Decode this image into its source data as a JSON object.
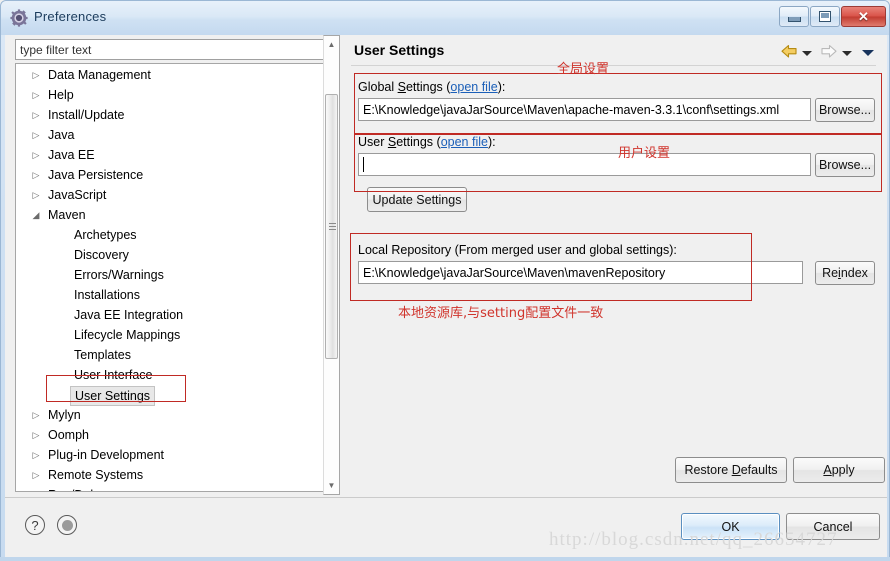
{
  "window": {
    "title": "Preferences",
    "icon": "gear-icon",
    "buttons": {
      "minimize": "minimize",
      "maximize": "maximize",
      "close": "✕"
    }
  },
  "sidebar": {
    "filter_placeholder": "type filter text",
    "items": [
      {
        "label": "Data Management",
        "level": 0,
        "expandable": true,
        "expanded": false,
        "selected": false
      },
      {
        "label": "Help",
        "level": 0,
        "expandable": true,
        "expanded": false,
        "selected": false
      },
      {
        "label": "Install/Update",
        "level": 0,
        "expandable": true,
        "expanded": false,
        "selected": false
      },
      {
        "label": "Java",
        "level": 0,
        "expandable": true,
        "expanded": false,
        "selected": false
      },
      {
        "label": "Java EE",
        "level": 0,
        "expandable": true,
        "expanded": false,
        "selected": false
      },
      {
        "label": "Java Persistence",
        "level": 0,
        "expandable": true,
        "expanded": false,
        "selected": false
      },
      {
        "label": "JavaScript",
        "level": 0,
        "expandable": true,
        "expanded": false,
        "selected": false
      },
      {
        "label": "Maven",
        "level": 0,
        "expandable": true,
        "expanded": true,
        "selected": false
      },
      {
        "label": "Archetypes",
        "level": 1,
        "expandable": false,
        "expanded": false,
        "selected": false
      },
      {
        "label": "Discovery",
        "level": 1,
        "expandable": false,
        "expanded": false,
        "selected": false
      },
      {
        "label": "Errors/Warnings",
        "level": 1,
        "expandable": false,
        "expanded": false,
        "selected": false
      },
      {
        "label": "Installations",
        "level": 1,
        "expandable": false,
        "expanded": false,
        "selected": false
      },
      {
        "label": "Java EE Integration",
        "level": 1,
        "expandable": false,
        "expanded": false,
        "selected": false
      },
      {
        "label": "Lifecycle Mappings",
        "level": 1,
        "expandable": false,
        "expanded": false,
        "selected": false
      },
      {
        "label": "Templates",
        "level": 1,
        "expandable": false,
        "expanded": false,
        "selected": false
      },
      {
        "label": "User Interface",
        "level": 1,
        "expandable": false,
        "expanded": false,
        "selected": false
      },
      {
        "label": "User Settings",
        "level": 1,
        "expandable": false,
        "expanded": false,
        "selected": true
      },
      {
        "label": "Mylyn",
        "level": 0,
        "expandable": true,
        "expanded": false,
        "selected": false
      },
      {
        "label": "Oomph",
        "level": 0,
        "expandable": true,
        "expanded": false,
        "selected": false
      },
      {
        "label": "Plug-in Development",
        "level": 0,
        "expandable": true,
        "expanded": false,
        "selected": false
      },
      {
        "label": "Remote Systems",
        "level": 0,
        "expandable": true,
        "expanded": false,
        "selected": false
      },
      {
        "label": "Run/Debug",
        "level": 0,
        "expandable": true,
        "expanded": false,
        "selected": false
      }
    ],
    "twisty_collapsed": "▷",
    "twisty_expanded": "◢",
    "scrollbar": {
      "up": "▲",
      "down": "▼"
    }
  },
  "panel": {
    "title": "User Settings",
    "nav": {
      "back": "back-arrow",
      "back_caret": "▼",
      "forward": "forward-arrow",
      "forward_caret": "▼",
      "menu_caret": "▼"
    },
    "global_settings": {
      "label_pre": "Global ",
      "label_mnemonic": "S",
      "label_post": "ettings (",
      "link": "open file",
      "label_end": "):",
      "value": "E:\\Knowledge\\javaJarSource\\Maven\\apache-maven-3.3.1\\conf\\settings.xml",
      "browse_label": "Browse..."
    },
    "user_settings": {
      "label_pre": "User ",
      "label_mnemonic": "S",
      "label_post": "ettings (",
      "link": "open file",
      "label_end": "):",
      "value": "",
      "browse_label": "Browse..."
    },
    "update_button": "Update Settings",
    "local_repository": {
      "label": "Local Repository (From merged user and global settings):",
      "value": "E:\\Knowledge\\javaJarSource\\Maven\\mavenRepository",
      "reindex_pre": "Re",
      "reindex_mnemonic": "i",
      "reindex_post": "ndex"
    },
    "restore_defaults": {
      "pre": "Restore ",
      "mn": "D",
      "post": "efaults"
    },
    "apply": {
      "pre": "",
      "mn": "A",
      "post": "pply"
    }
  },
  "annotations": [
    {
      "text": "全局设置"
    },
    {
      "text": "用户设置"
    },
    {
      "text": "本地资源库,与setting配置文件一致"
    }
  ],
  "footer": {
    "help_icon": "?",
    "pin_icon": "pin-icon",
    "ok": "OK",
    "cancel": "Cancel"
  },
  "watermark": "http://blog.csdn.net/qq_26654727",
  "colors": {
    "annotation_red": "#d0342c",
    "link_blue": "#1b5fb8",
    "title_blue": "#1c3c5c",
    "close_red": "#c23c31"
  }
}
